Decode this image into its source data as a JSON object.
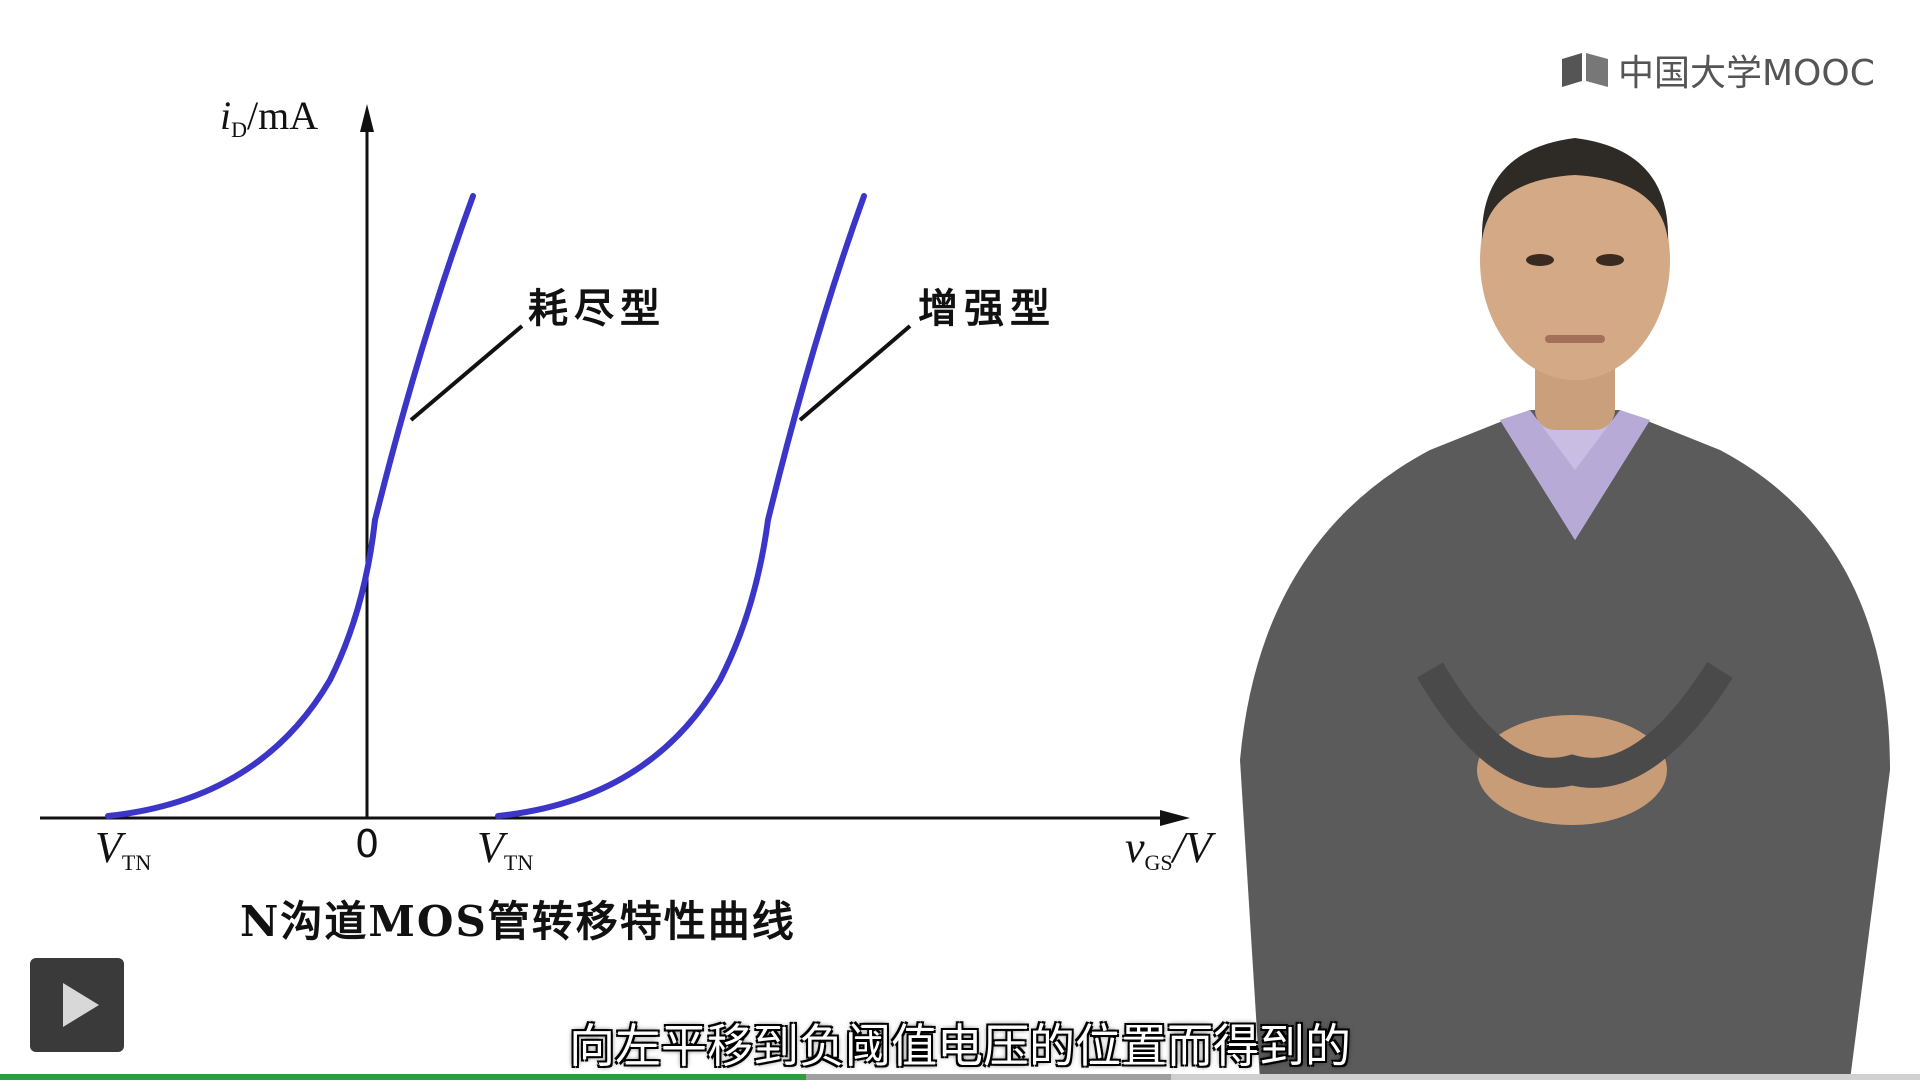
{
  "brand": {
    "text": "中国大学MOOC",
    "icon": "mooc-logo-icon"
  },
  "figure": {
    "y_axis_label_main": "i",
    "y_axis_label_sub": "D",
    "y_axis_label_unit": "/mA",
    "x_axis_label_main": "v",
    "x_axis_label_sub": "GS",
    "x_axis_label_unit": "/V",
    "origin": "0",
    "vtn_main": "V",
    "vtn_sub": "TN",
    "curve_depletion": "耗尽型",
    "curve_enhancement": "增强型",
    "caption": "N沟道MOS管转移特性曲线",
    "curve_color": "#3b35c8"
  },
  "player": {
    "subtitle": "向左平移到负阈值电压的位置而得到的",
    "play_icon": "play-icon",
    "progress_fraction": 0.42,
    "buffered_fraction": 0.61,
    "progress_color": "#2f9e3a"
  }
}
